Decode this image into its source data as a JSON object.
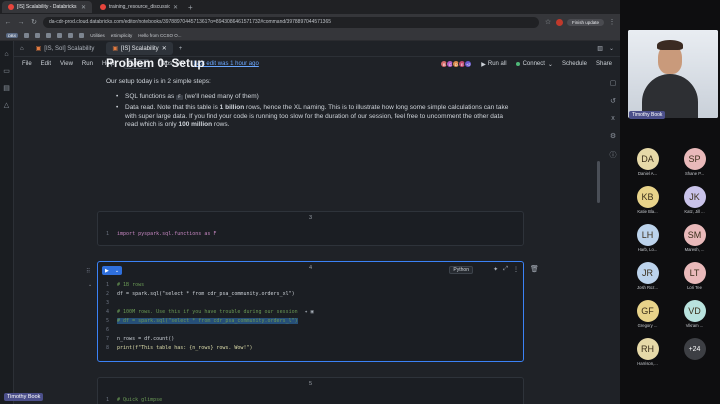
{
  "browser": {
    "tabs": [
      {
        "label": "[IS] Scalability - Databricks",
        "active": true
      },
      {
        "label": "training_resource_discussion",
        "active": false
      }
    ],
    "url": "da-cdr-prod.cloud.databricks.com/editor/notebooks/3978897044571361?o=8943086461571732#command/3978897044571365",
    "finish_update": "Finish update",
    "bookmarks": [
      "DBX",
      "Utilities",
      "eSimplicity",
      "Hello from CCSO O..."
    ]
  },
  "app": {
    "file_tabs": [
      {
        "label": "[IS, SoI] Scalability",
        "active": false
      },
      {
        "label": "[IS] Scalability",
        "active": true
      }
    ],
    "menu": [
      "File",
      "Edit",
      "View",
      "Run",
      "Help"
    ],
    "language": "Python",
    "tabs_setting": "Tabs: ON",
    "last_edit": "Last edit was 1 hour ago",
    "collaborators": [
      {
        "initials": "B",
        "color": "#d46b6b"
      },
      {
        "initials": "C",
        "color": "#b05bc4"
      },
      {
        "initials": "D",
        "color": "#d98a4b"
      },
      {
        "initials": "E",
        "color": "#c44a6f"
      },
      {
        "initials": "+2",
        "color": "#6a5acd"
      }
    ],
    "run_all": "Run all",
    "connect": "Connect",
    "schedule": "Schedule",
    "share": "Share"
  },
  "notebook": {
    "heading": "Problem 0: Setup",
    "intro": "Our setup today is in 2 simple steps:",
    "bullet1_pre": "SQL functions as",
    "bullet1_chip": "F",
    "bullet1_post": "(we'll need many of them)",
    "bullet2_a": "Data read. Note that this table is",
    "bullet2_b": "1 billion",
    "bullet2_c": "rows, hence the XL naming. This is to illustrate how long some simple calculations can take with super large data. If you find your code is running too slow for the duration of our session, feel free to uncomment the other data read which is only",
    "bullet2_d": "100 million",
    "bullet2_e": "rows.",
    "cells": [
      {
        "number": "3",
        "lines": [
          {
            "n": "1",
            "text": "import pyspark.sql.functions as F"
          }
        ]
      },
      {
        "number": "4",
        "language_tag": "Python",
        "lines": [
          {
            "n": "1",
            "text": "# 1B rows"
          },
          {
            "n": "2",
            "text": "df = spark.sql(\"select * from cdr_psa_community.orders_xl\")"
          },
          {
            "n": "3",
            "text": ""
          },
          {
            "n": "4",
            "text": "# 100M rows. Use this if you have trouble during our session"
          },
          {
            "n": "5",
            "text": "# df = spark.sql(\"select * from cdr_psa_community.orders_l\")"
          },
          {
            "n": "6",
            "text": ""
          },
          {
            "n": "7",
            "text": "n_rows = df.count()"
          },
          {
            "n": "8",
            "text": "print(f\"This table has: {n_rows} rows. Wow!\")"
          }
        ]
      },
      {
        "number": "5",
        "lines": [
          {
            "n": "1",
            "text": "# Quick glimpse"
          }
        ]
      }
    ]
  },
  "meeting": {
    "speaker": "Timothy Book",
    "participants": [
      {
        "initials": "DA",
        "name": "Daniel A...",
        "color": "#e6d9a8"
      },
      {
        "initials": "SP",
        "name": "Shane P...",
        "color": "#e9b9ba"
      },
      {
        "initials": "KB",
        "name": "Katie Bla...",
        "color": "#e8d38a"
      },
      {
        "initials": "JK",
        "name": "Katz, Jill ...",
        "color": "#c9c3ea"
      },
      {
        "initials": "LH",
        "name": "Harb, Lo...",
        "color": "#bcd3ec"
      },
      {
        "initials": "SM",
        "name": "Maresh, ...",
        "color": "#e9b9ba"
      },
      {
        "initials": "JR",
        "name": "Josh Roz...",
        "color": "#bcd3ec"
      },
      {
        "initials": "LT",
        "name": "Lori Tee",
        "color": "#e9b9ba"
      },
      {
        "initials": "GF",
        "name": "Gregory ...",
        "color": "#e8d38a"
      },
      {
        "initials": "VD",
        "name": "Vikram ...",
        "color": "#b8e2de"
      },
      {
        "initials": "RH",
        "name": "Harrison,...",
        "color": "#e6d9a8"
      }
    ],
    "more": "+24",
    "self_label": "Timothy Book"
  }
}
